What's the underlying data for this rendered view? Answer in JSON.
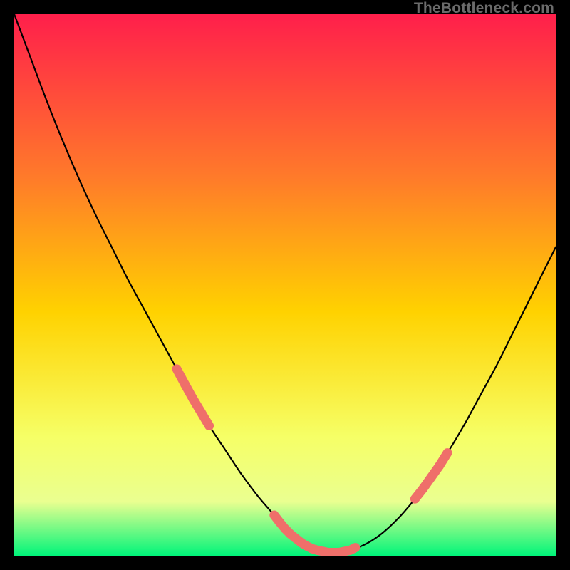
{
  "attribution": "TheBottleneck.com",
  "colors": {
    "bg": "#000000",
    "grad_top": "#ff1f4b",
    "grad_mid1": "#ff7a2a",
    "grad_mid2": "#ffd200",
    "grad_low1": "#f6ff66",
    "grad_low2": "#eaff90",
    "grad_bottom": "#00f47a",
    "curve": "#000000",
    "marker": "#ef6f6a"
  },
  "chart_data": {
    "type": "line",
    "title": "",
    "xlabel": "",
    "ylabel": "",
    "xlim": [
      0,
      100
    ],
    "ylim": [
      0,
      100
    ],
    "grid": false,
    "legend": false,
    "x": [
      0,
      3,
      6,
      9,
      12,
      15,
      18,
      21,
      24,
      27,
      30,
      33,
      36,
      39,
      42,
      45,
      48,
      50,
      52,
      54,
      56,
      58,
      60,
      62,
      65,
      68,
      71,
      74,
      77,
      80,
      83,
      86,
      89,
      92,
      95,
      98,
      100
    ],
    "values": [
      100,
      92,
      84,
      76.5,
      69.5,
      63,
      57,
      51,
      45.5,
      40,
      34.5,
      29,
      24,
      19.5,
      15,
      11,
      7.5,
      5,
      3.2,
      1.8,
      1,
      0.6,
      0.6,
      1,
      2.2,
      4.2,
      7,
      10.5,
      14.5,
      19,
      24,
      29.5,
      35,
      41,
      47,
      53,
      57
    ],
    "marker_segments": [
      {
        "x": [
          30,
          31.5,
          33,
          34.5,
          36
        ],
        "y": [
          34.5,
          31.7,
          29,
          26.5,
          24
        ]
      },
      {
        "x": [
          48,
          49,
          50,
          51,
          52,
          53,
          54,
          55,
          56,
          57,
          58,
          59,
          60,
          61,
          62,
          63
        ],
        "y": [
          7.5,
          6.2,
          5,
          4,
          3.2,
          2.4,
          1.8,
          1.3,
          1,
          0.8,
          0.6,
          0.6,
          0.6,
          0.8,
          1,
          1.5
        ]
      },
      {
        "x": [
          74,
          75.5,
          77,
          78.5,
          80
        ],
        "y": [
          10.5,
          12.4,
          14.5,
          16.6,
          19
        ]
      }
    ]
  }
}
